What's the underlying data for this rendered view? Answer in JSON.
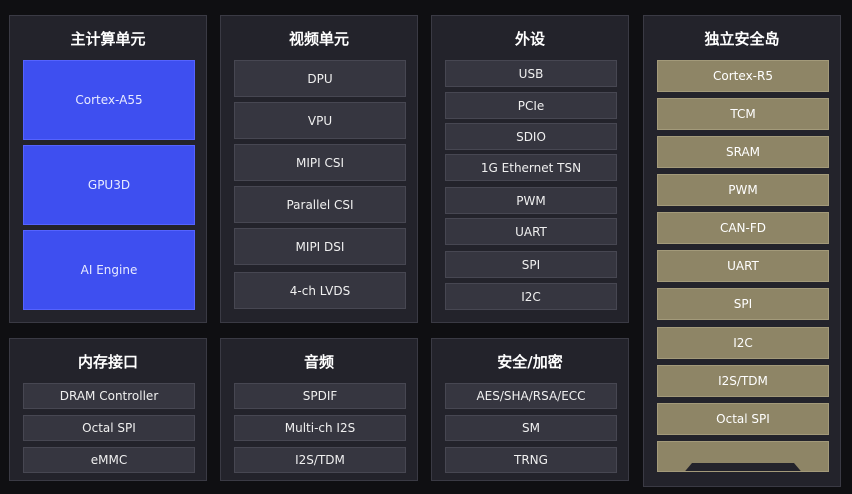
{
  "main_compute": {
    "title": "主计算单元",
    "items": [
      "Cortex-A55",
      "GPU3D",
      "AI Engine"
    ]
  },
  "video": {
    "title": "视频单元",
    "items": [
      "DPU",
      "VPU",
      "MIPI CSI",
      "Parallel CSI",
      "MIPI DSI",
      "4-ch LVDS"
    ]
  },
  "peripherals": {
    "title": "外设",
    "items": [
      "USB",
      "PCIe",
      "SDIO",
      "1G Ethernet TSN",
      "PWM",
      "UART",
      "SPI",
      "I2C"
    ]
  },
  "safety_island": {
    "title": "独立安全岛",
    "items": [
      "Cortex-R5",
      "TCM",
      "SRAM",
      "PWM",
      "CAN-FD",
      "UART",
      "SPI",
      "I2C",
      "I2S/TDM",
      "Octal SPI",
      ""
    ]
  },
  "memory": {
    "title": "内存接口",
    "items": [
      "DRAM Controller",
      "Octal SPI",
      "eMMC"
    ]
  },
  "audio": {
    "title": "音频",
    "items": [
      "SPDIF",
      "Multi-ch I2S",
      "I2S/TDM"
    ]
  },
  "security": {
    "title": "安全/加密",
    "items": [
      "AES/SHA/RSA/ECC",
      "SM",
      "TRNG"
    ]
  },
  "colors": {
    "background": "#0f0f12",
    "panel": "#23232b",
    "cell": "#363640",
    "compute_blue": "#3e4ff0",
    "island_gold": "#8e8566"
  }
}
